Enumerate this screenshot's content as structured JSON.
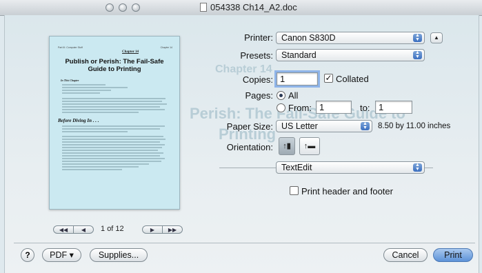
{
  "window": {
    "title": "054338 Ch14_A2.doc"
  },
  "preview": {
    "header_left": "Part III: Computer Stuff",
    "header_right": "Chapter 14",
    "chapter": "Chapter 14",
    "title": "Publish or Perish: The Fail-Safe Guide to Printing",
    "subhead": "In This Chapter",
    "section": "Before Diving In . . .",
    "page_current": "1",
    "page_of": "of 12"
  },
  "printer": {
    "label": "Printer:",
    "value": "Canon S830D"
  },
  "presets": {
    "label": "Presets:",
    "value": "Standard"
  },
  "copies": {
    "label": "Copies:",
    "value": "1",
    "collated_label": "Collated",
    "collated_checked": true
  },
  "pages": {
    "label": "Pages:",
    "all_label": "All",
    "from_label": "From:",
    "from_value": "1",
    "to_label": "to:",
    "to_value": "1"
  },
  "paper_size": {
    "label": "Paper Size:",
    "value": "US Letter",
    "dimensions": "8.50 by 11.00 inches"
  },
  "orientation": {
    "label": "Orientation:",
    "portrait_icon": "portrait-icon",
    "landscape_icon": "landscape-icon"
  },
  "app_menu": {
    "value": "TextEdit"
  },
  "header_footer": {
    "label": "Print header and footer",
    "checked": false
  },
  "buttons": {
    "help": "?",
    "pdf": "PDF ▾",
    "supplies": "Supplies...",
    "cancel": "Cancel",
    "print": "Print"
  },
  "colors": {
    "accent": "#3b6fc0",
    "preview_tint": "#cbe9f1"
  }
}
